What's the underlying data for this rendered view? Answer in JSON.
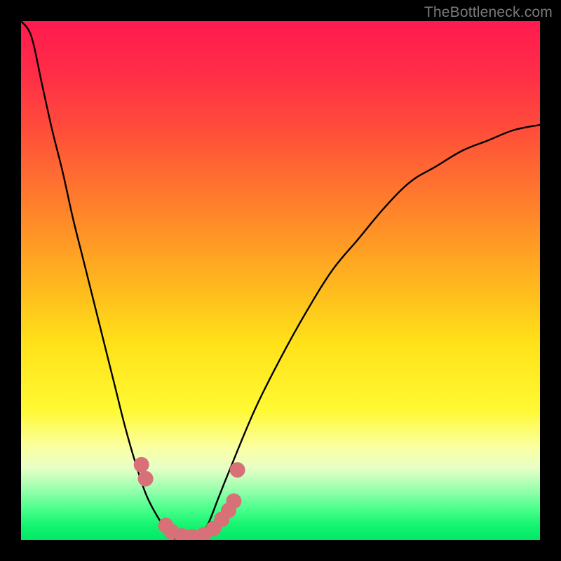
{
  "watermark": "TheBottleneck.com",
  "chart_data": {
    "type": "line",
    "title": "",
    "xlabel": "",
    "ylabel": "",
    "x": [
      0.0,
      0.02,
      0.04,
      0.06,
      0.08,
      0.1,
      0.12,
      0.14,
      0.16,
      0.18,
      0.2,
      0.22,
      0.24,
      0.26,
      0.28,
      0.3,
      0.32,
      0.34,
      0.36,
      0.38,
      0.4,
      0.45,
      0.5,
      0.55,
      0.6,
      0.65,
      0.7,
      0.75,
      0.8,
      0.85,
      0.9,
      0.95,
      1.0
    ],
    "y": [
      1.0,
      0.97,
      0.88,
      0.79,
      0.71,
      0.62,
      0.54,
      0.46,
      0.38,
      0.3,
      0.22,
      0.15,
      0.09,
      0.05,
      0.02,
      0.0,
      0.0,
      0.0,
      0.03,
      0.08,
      0.13,
      0.25,
      0.35,
      0.44,
      0.52,
      0.58,
      0.64,
      0.69,
      0.72,
      0.75,
      0.77,
      0.79,
      0.8
    ],
    "xlim": [
      0,
      1
    ],
    "ylim": [
      0,
      1
    ],
    "minimum_x": 0.32,
    "gradient_stops": [
      {
        "pos": 0.0,
        "color": "#ff1a4f"
      },
      {
        "pos": 0.1,
        "color": "#ff2d47"
      },
      {
        "pos": 0.2,
        "color": "#ff4a3b"
      },
      {
        "pos": 0.35,
        "color": "#ff7e2c"
      },
      {
        "pos": 0.5,
        "color": "#ffb41f"
      },
      {
        "pos": 0.62,
        "color": "#ffe119"
      },
      {
        "pos": 0.75,
        "color": "#fff933"
      },
      {
        "pos": 0.82,
        "color": "#fbffa0"
      },
      {
        "pos": 0.86,
        "color": "#e9ffc7"
      },
      {
        "pos": 0.9,
        "color": "#9fffb0"
      },
      {
        "pos": 0.94,
        "color": "#4bff8c"
      },
      {
        "pos": 0.97,
        "color": "#17f572"
      },
      {
        "pos": 1.0,
        "color": "#00e865"
      }
    ],
    "markers": {
      "color": "#d87077",
      "radius_px": 11,
      "points_plot_xy": [
        [
          0.232,
          0.145
        ],
        [
          0.24,
          0.118
        ],
        [
          0.279,
          0.028
        ],
        [
          0.29,
          0.016
        ],
        [
          0.31,
          0.008
        ],
        [
          0.33,
          0.006
        ],
        [
          0.352,
          0.01
        ],
        [
          0.371,
          0.022
        ],
        [
          0.387,
          0.04
        ],
        [
          0.4,
          0.057
        ],
        [
          0.41,
          0.075
        ],
        [
          0.417,
          0.135
        ]
      ]
    }
  }
}
